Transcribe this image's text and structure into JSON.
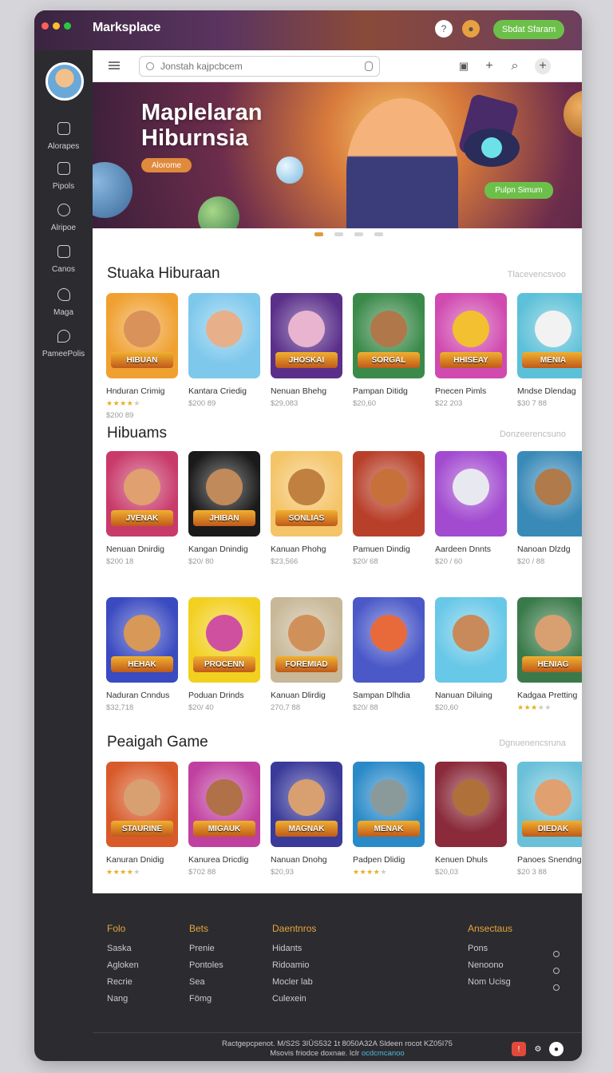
{
  "app": {
    "title": "Marksplace",
    "cta": "Sbdat Sfaram",
    "colors": {
      "accent": "#e09a3c",
      "green": "#6cc04a",
      "dark": "#2c2c30"
    }
  },
  "titlebar_icons": [
    "help-icon",
    "user-icon"
  ],
  "sidebar": {
    "items": [
      {
        "label": "Alorapes",
        "icon": "gamepad-icon"
      },
      {
        "label": "Pipols",
        "icon": "grid-icon"
      },
      {
        "label": "Alripoe",
        "icon": "people-icon"
      },
      {
        "label": "Canos",
        "icon": "square-icon"
      },
      {
        "label": "Maga",
        "icon": "bird-icon"
      },
      {
        "label": "PameePolis",
        "icon": "pin-icon"
      }
    ]
  },
  "topbar": {
    "search_placeholder": "Jonstah kajpcbcem",
    "icons": [
      "cart-icon",
      "plus-icon",
      "search-icon",
      "add-circle-icon"
    ]
  },
  "hero": {
    "title": "Maplelaran Hiburnsia",
    "badge": "Alorome",
    "cta": "Pulpn Simum",
    "slides": 4,
    "active_slide": 0
  },
  "sections": [
    {
      "title": "Stuaka Hiburaan",
      "more": "Tlacevencsvoo",
      "rows": [
        [
          {
            "banner": "HIBUAN",
            "name": "Hnduran Crimig",
            "price": "$200 89",
            "stars": 4,
            "bg": "#f0a030",
            "face": "#d9925a"
          },
          {
            "banner": "",
            "name": "Kantara Criedig",
            "price": "$200 89",
            "stars": 0,
            "bg": "#7ec8ec",
            "face": "#e7b08a"
          },
          {
            "banner": "JHOSKAI",
            "name": "Nenuan Bhehg",
            "price": "$29,083",
            "stars": 0,
            "bg": "#5a2f8a",
            "face": "#e8b4d0"
          },
          {
            "banner": "SORGAL",
            "name": "Pampan Ditidg",
            "price": "$20,60",
            "stars": 0,
            "bg": "#3b8a4a",
            "face": "#b0784a"
          },
          {
            "banner": "HHISEAY",
            "name": "Pnecen Pimls",
            "price": "$22 203",
            "stars": 0,
            "bg": "#d04ab0",
            "face": "#f2c030"
          },
          {
            "banner": "MENIA",
            "name": "Mndse Dlendag",
            "price": "$30 7 88",
            "stars": 0,
            "bg": "#5cc0d8",
            "face": "#f2f2f2"
          }
        ]
      ]
    },
    {
      "title": "Hibuams",
      "more": "Donzeerencsuno",
      "rows": [
        [
          {
            "banner": "JVENAK",
            "name": "Nenuan Dnirdig",
            "price": "$200 18",
            "stars": 0,
            "bg": "#c83a6a",
            "face": "#e0a070"
          },
          {
            "banner": "JHIBAN",
            "name": "Kangan Dnindig",
            "price": "$20/ 80",
            "stars": 0,
            "bg": "#1a1a1a",
            "face": "#c08a5a"
          },
          {
            "banner": "SONLIAS",
            "name": "Kanuan Phohg",
            "price": "$23,566",
            "stars": 0,
            "bg": "#f4c468",
            "face": "#c08040"
          },
          {
            "banner": "",
            "name": "Pamuen Dindig",
            "price": "$20/ 68",
            "stars": 0,
            "bg": "#b8402a",
            "face": "#c8703a"
          },
          {
            "banner": "",
            "name": "Aardeen Dnnts",
            "price": "$20 / 60",
            "stars": 0,
            "bg": "#a24ad0",
            "face": "#e8e8f0"
          },
          {
            "banner": "",
            "name": "Nanoan Dlzdg",
            "price": "$20 / 88",
            "stars": 0,
            "bg": "#3a8ab8",
            "face": "#b07a4a"
          }
        ],
        [
          {
            "banner": "HEHAK",
            "name": "Naduran Cnndus",
            "price": "$32,718",
            "stars": 0,
            "bg": "#3a4ac0",
            "face": "#d89858"
          },
          {
            "banner": "PROCENN",
            "name": "Poduan Drinds",
            "price": "$20/ 40",
            "stars": 0,
            "bg": "#f2d020",
            "face": "#d050a0"
          },
          {
            "banner": "FOREMIAD",
            "name": "Kanuan Dlirdig",
            "price": "270,7 88",
            "stars": 0,
            "bg": "#c8b898",
            "face": "#d0905a"
          },
          {
            "banner": "",
            "name": "Sampan Dlhdia",
            "price": "$20/ 88",
            "stars": 0,
            "bg": "#4a58c8",
            "face": "#e86a3a"
          },
          {
            "banner": "",
            "name": "Nanuan Diluing",
            "price": "$20,60",
            "stars": 0,
            "bg": "#68c8e8",
            "face": "#c88a5a"
          },
          {
            "banner": "HENIAG",
            "name": "Kadgaa Pretting",
            "price": "",
            "stars": 3,
            "bg": "#3a7a4a",
            "face": "#d8a070"
          }
        ]
      ]
    },
    {
      "title": "Peaigah Game",
      "more": "Dgnuenencsruna",
      "rows": [
        [
          {
            "banner": "STAURINE",
            "name": "Kanuran Dnidig",
            "price": "",
            "stars": 4,
            "bg": "#d85a2a",
            "face": "#d8a070"
          },
          {
            "banner": "MIGAUK",
            "name": "Kanurea Dricdig",
            "price": "$702 88",
            "stars": 0,
            "bg": "#c040a0",
            "face": "#b07048"
          },
          {
            "banner": "MAGNAK",
            "name": "Nanuan Dnohg",
            "price": "$20,93",
            "stars": 0,
            "bg": "#3a3a9a",
            "face": "#d8a070"
          },
          {
            "banner": "MENAK",
            "name": "Padpen Dlidig",
            "price": "",
            "stars": 4,
            "bg": "#2a8ac8",
            "face": "#8a9a9a"
          },
          {
            "banner": "",
            "name": "Kenuen Dhuls",
            "price": "$20,03",
            "stars": 0,
            "bg": "#8a2a3a",
            "face": "#b0703a"
          },
          {
            "banner": "DIEDAK",
            "name": "Panoes Snendng",
            "price": "$20 3 88",
            "stars": 0,
            "bg": "#6ac0d8",
            "face": "#e0a070"
          }
        ]
      ]
    }
  ],
  "footer": {
    "columns": [
      {
        "head": "Folo",
        "links": [
          "Saska",
          "Agloken",
          "Recrie",
          "Nang"
        ]
      },
      {
        "head": "Bets",
        "links": [
          "Prenie",
          "Pontoles",
          "Sea",
          "Fömg"
        ]
      },
      {
        "head": "Daentnros",
        "links": [
          "Hidants",
          "Ridoamio",
          "Mocler lab",
          "Culexein"
        ]
      },
      {
        "head": "Ansectaus",
        "links": [
          "Pons",
          "Nenoono",
          "Nom Ucisg"
        ]
      }
    ],
    "copyright_line1": "Ractgepcpenot. M/S2S 3IÜS532 1t 8050A32A Sldeen rocot KZ05I75",
    "copyright_line2_prefix": "Msovis friodce doxnae. lclr",
    "copyright_line2_link": "ocdcmcanoo",
    "bottom_icons": [
      "flag-icon",
      "gear-icon",
      "user-icon"
    ]
  }
}
